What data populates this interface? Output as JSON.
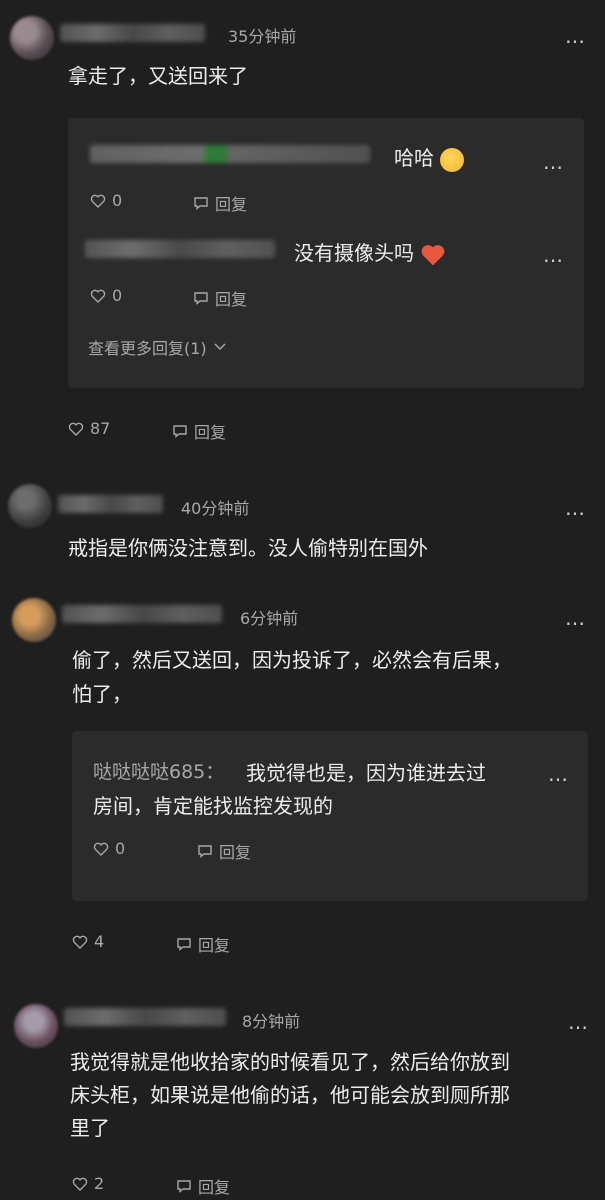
{
  "comments": [
    {
      "time": "35分钟前",
      "text": "拿走了，又送回来了",
      "replies": [
        {
          "text": "哈哈",
          "likes": "0",
          "reply_label": "回复"
        },
        {
          "text": "没有摄像头吗",
          "likes": "0",
          "reply_label": "回复"
        }
      ],
      "more_replies": "查看更多回复(1)",
      "likes": "87",
      "reply_label": "回复"
    },
    {
      "time": "40分钟前",
      "text": "戒指是你俩没注意到。没人偷特别在国外"
    },
    {
      "time": "6分钟前",
      "text_line1": "偷了，然后又送回，因为投诉了，必然会有后果，",
      "text_line2": "怕了，",
      "replies": [
        {
          "username": "哒哒哒哒685：",
          "text_line1": "我觉得也是，因为谁进去过",
          "text_line2": "房间，肯定能找监控发现的",
          "likes": "0",
          "reply_label": "回复"
        }
      ],
      "likes": "4",
      "reply_label": "回复"
    },
    {
      "time": "8分钟前",
      "text_line1": "我觉得就是他收拾家的时候看见了，然后给你放到",
      "text_line2": "床头柜，如果说是他偷的话，他可能会放到厕所那",
      "text_line3": "里了",
      "likes": "2",
      "reply_label": "回复"
    }
  ],
  "more_glyph": "…",
  "icons": {
    "like": "heart-icon",
    "reply": "comment-bubble-icon",
    "expand": "chevron-down-icon"
  }
}
